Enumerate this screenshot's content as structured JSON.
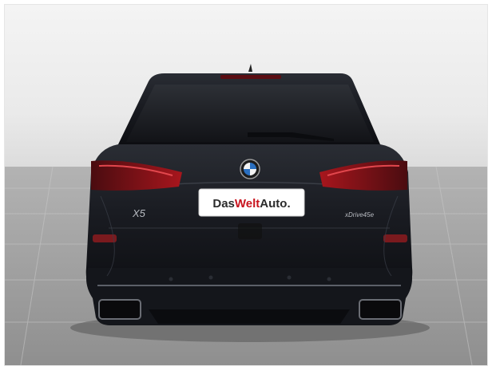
{
  "photo": {
    "subject": "BMW X5 xDrive45e rear view",
    "badge_model": "X5",
    "badge_variant": "xDrive45e",
    "plate": {
      "part1": "Das",
      "part2": "Welt",
      "part3": "Auto."
    }
  },
  "colors": {
    "car_body": "#15171c",
    "plate_red": "#c8141e",
    "taillight": "#8a1218"
  }
}
